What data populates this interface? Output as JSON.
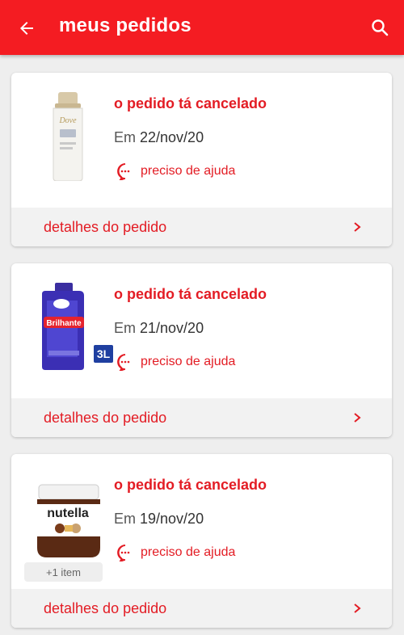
{
  "header": {
    "title": "meus pedidos",
    "background_color": "#f41c22",
    "back_icon": "arrow-left-icon",
    "search_icon": "search-icon"
  },
  "orders": [
    {
      "product": "Dove shampoo",
      "status": "o pedido tá cancelado",
      "date_prefix": "Em",
      "date": "22/nov/20",
      "help_label": "preciso de ajuda",
      "details_label": "detalhes do pedido"
    },
    {
      "product": "Brilhante sabão líquido",
      "badge": "3L",
      "status": "o pedido tá cancelado",
      "date_prefix": "Em",
      "date": "21/nov/20",
      "help_label": "preciso de ajuda",
      "details_label": "detalhes do pedido"
    },
    {
      "product": "nutella",
      "extra_items": "+1 item",
      "status": "o pedido tá cancelado",
      "date_prefix": "Em",
      "date": "19/nov/20",
      "help_label": "preciso de ajuda",
      "details_label": "detalhes do pedido"
    }
  ],
  "colors": {
    "accent": "#e31c24",
    "card_footer": "#f2f2f2",
    "page_background": "#eeeeee"
  }
}
